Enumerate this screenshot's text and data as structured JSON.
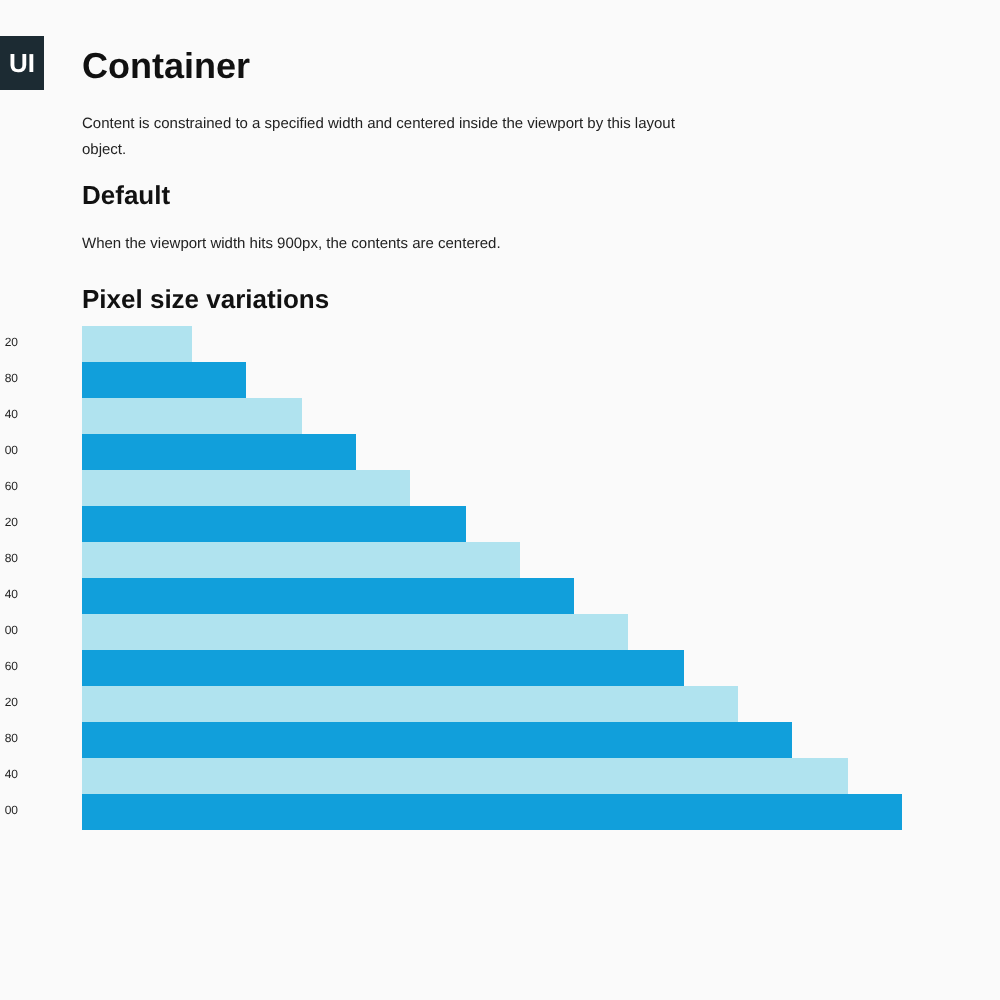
{
  "logo": "UI",
  "title": "Container",
  "intro": "Content is constrained to a specified width and centered inside the viewport by this layout object.",
  "default_heading": "Default",
  "default_text": "When the viewport width hits 900px, the contents are centered.",
  "variations_heading": "Pixel size variations",
  "bars": [
    {
      "label": "20",
      "color": "#b0e3ef"
    },
    {
      "label": "80",
      "color": "#119fdb"
    },
    {
      "label": "40",
      "color": "#b0e3ef"
    },
    {
      "label": "00",
      "color": "#119fdb"
    },
    {
      "label": "60",
      "color": "#b0e3ef"
    },
    {
      "label": "20",
      "color": "#119fdb"
    },
    {
      "label": "80",
      "color": "#b0e3ef"
    },
    {
      "label": "40",
      "color": "#119fdb"
    },
    {
      "label": "00",
      "color": "#b0e3ef"
    },
    {
      "label": "60",
      "color": "#119fdb"
    },
    {
      "label": "20",
      "color": "#b0e3ef"
    },
    {
      "label": "80",
      "color": "#119fdb"
    },
    {
      "label": "40",
      "color": "#b0e3ef"
    },
    {
      "label": "00",
      "color": "#119fdb"
    }
  ]
}
